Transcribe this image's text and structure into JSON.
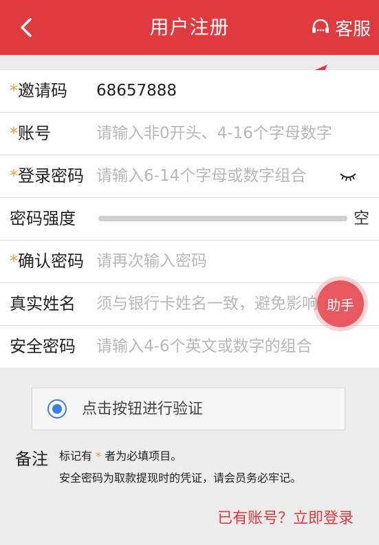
{
  "header": {
    "title": "用户注册",
    "service_label": "客服",
    "bg_color": "#e03a3e"
  },
  "form": {
    "invite": {
      "label": "邀请码",
      "value": "68657888",
      "required": true
    },
    "account": {
      "label": "账号",
      "placeholder": "请输入非0开头、4-16个字母数字",
      "required": true
    },
    "password": {
      "label": "登录密码",
      "placeholder": "请输入6-14个字母或数字组合",
      "required": true
    },
    "strength": {
      "label": "密码强度",
      "value_text": "空",
      "level": 0
    },
    "confirm": {
      "label": "确认密码",
      "placeholder": "请再次输入密码",
      "required": true
    },
    "realname": {
      "label": "真实姓名",
      "placeholder": "须与银行卡姓名一致，避免影响",
      "required": false
    },
    "safe_pwd": {
      "label": "安全密码",
      "placeholder": "请输入4-6个英文或数字的组合",
      "required": false
    }
  },
  "required_mark": "*",
  "helper_button": "助手",
  "verify": {
    "label": "点击按钮进行验证"
  },
  "note": {
    "label": "备注",
    "line1_a": "标记有",
    "line1_star": "*",
    "line1_b": "者为必填项目。",
    "line2": "安全密码为取款提现时的凭证，请会员务必牢记。"
  },
  "login_link": "已有账号？立即登录"
}
